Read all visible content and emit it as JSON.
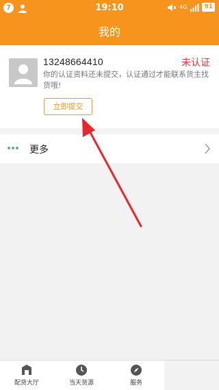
{
  "status_bar": {
    "badge": "7",
    "time": "19:10",
    "network": "4G",
    "battery": "91"
  },
  "header": {
    "title": "我的"
  },
  "profile": {
    "phone": "13248664410",
    "status": "未认证",
    "description": "你的认证资料还未提交，认证通过才能联系货主找货哦!",
    "submit_label": "立即提交"
  },
  "menu": {
    "more_label": "更多"
  },
  "bottom_nav": {
    "items": [
      {
        "label": "配货大厅",
        "icon": "warehouse-icon"
      },
      {
        "label": "当天货源",
        "icon": "clock-icon"
      },
      {
        "label": "服务",
        "icon": "compass-icon"
      }
    ]
  },
  "colors": {
    "brand": "#f7941d",
    "status_red": "#e33333",
    "arrow": "#e8262c"
  }
}
